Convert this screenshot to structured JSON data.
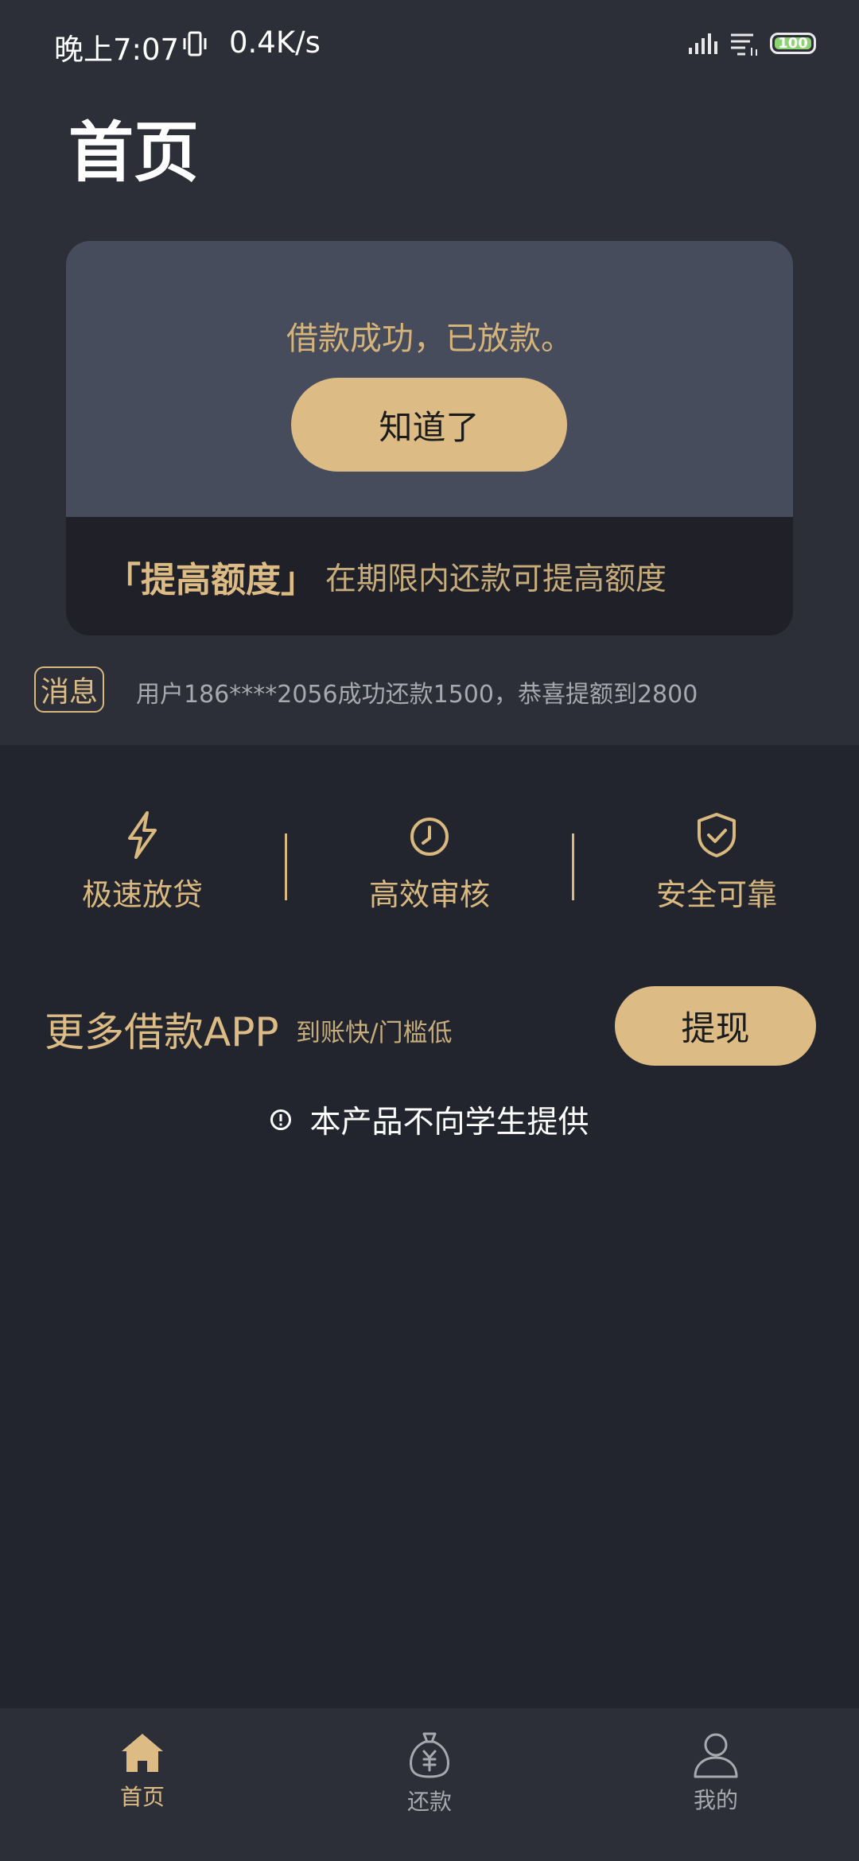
{
  "status_bar": {
    "time": "晚上7:07",
    "net_speed": "0.4K/s",
    "battery": "100"
  },
  "header": {
    "title": "首页"
  },
  "card": {
    "message": "借款成功，已放款。",
    "button_label": "知道了",
    "highlight_title": "「提高额度」",
    "tip": "在期限内还款可提高额度"
  },
  "message_bar": {
    "badge": "消息",
    "text": "用户186****2056成功还款1500，恭喜提额到2800"
  },
  "features": [
    {
      "label": "极速放贷",
      "icon": "lightning-icon"
    },
    {
      "label": "高效审核",
      "icon": "clock-icon"
    },
    {
      "label": "安全可靠",
      "icon": "shield-check-icon"
    }
  ],
  "more": {
    "title": "更多借款APP",
    "subtitle": "到账快/门槛低",
    "button_label": "提现"
  },
  "notice": {
    "text": "本产品不向学生提供"
  },
  "nav": [
    {
      "label": "首页",
      "icon": "home-icon",
      "active": true
    },
    {
      "label": "还款",
      "icon": "money-bag-icon",
      "active": false
    },
    {
      "label": "我的",
      "icon": "person-icon",
      "active": false
    }
  ],
  "colors": {
    "accent": "#dcbc84",
    "background": "#22252e",
    "top_background": "#2c2f38",
    "card_upper": "#474c5d",
    "card_lower": "#1f2028"
  }
}
